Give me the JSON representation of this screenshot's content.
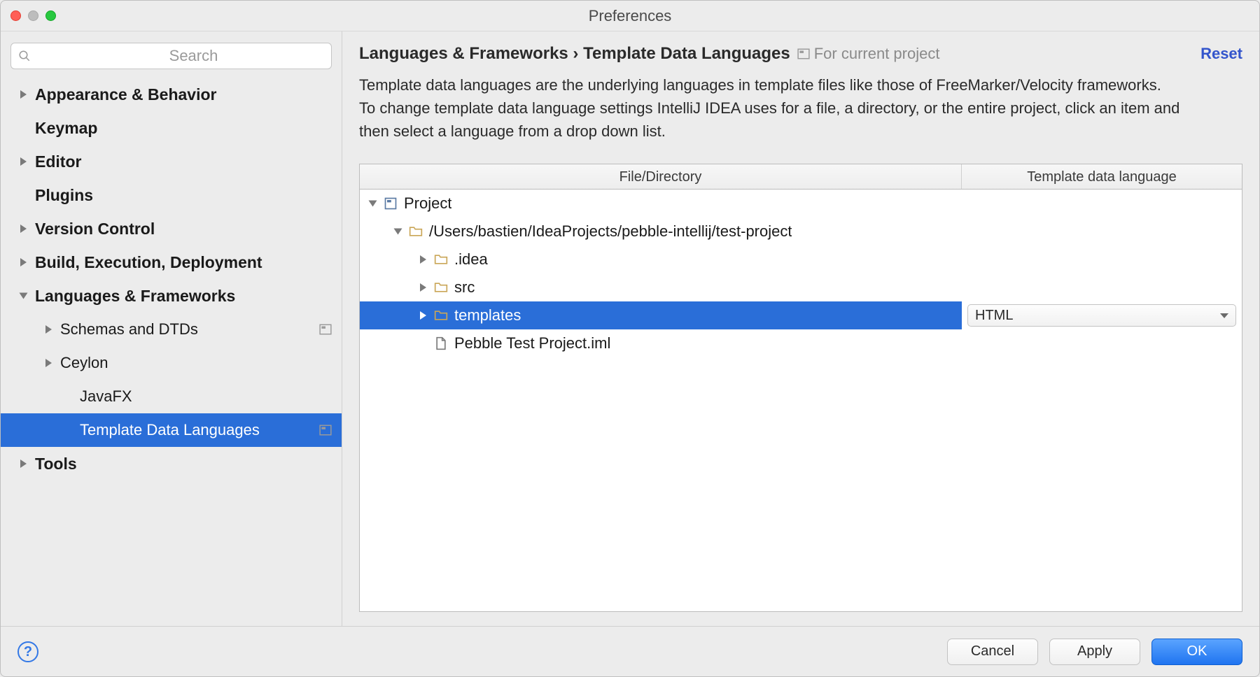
{
  "window": {
    "title": "Preferences"
  },
  "search": {
    "placeholder": "Search"
  },
  "sidebar": {
    "items": [
      {
        "label": "Appearance & Behavior",
        "bold": true,
        "expandable": true
      },
      {
        "label": "Keymap",
        "bold": true,
        "expandable": false
      },
      {
        "label": "Editor",
        "bold": true,
        "expandable": true
      },
      {
        "label": "Plugins",
        "bold": true,
        "expandable": false
      },
      {
        "label": "Version Control",
        "bold": true,
        "expandable": true
      },
      {
        "label": "Build, Execution, Deployment",
        "bold": true,
        "expandable": true
      },
      {
        "label": "Languages & Frameworks",
        "bold": true,
        "expandable": true,
        "open": true
      },
      {
        "label": "Schemas and DTDs",
        "child": true,
        "expandable": true,
        "scope": true
      },
      {
        "label": "Ceylon",
        "child": true,
        "expandable": true
      },
      {
        "label": "JavaFX",
        "grandchild": true,
        "expandable": false
      },
      {
        "label": "Template Data Languages",
        "grandchild": true,
        "expandable": false,
        "scope": true,
        "selected": true
      },
      {
        "label": "Tools",
        "bold": true,
        "expandable": true
      }
    ]
  },
  "main": {
    "breadcrumb1": "Languages & Frameworks",
    "breadcrumb_sep": " › ",
    "breadcrumb2": "Template Data Languages",
    "scope_label": "For current project",
    "reset": "Reset",
    "description": "Template data languages are the underlying languages in template files like those of FreeMarker/Velocity frameworks.\nTo change template data language settings IntelliJ IDEA uses for a file, a directory, or the entire project, click an item and then select a language from a drop down list."
  },
  "table": {
    "col1": "File/Directory",
    "col2": "Template data language",
    "rows": [
      {
        "indent": 0,
        "disclosure": "open",
        "icon": "project",
        "label": "Project"
      },
      {
        "indent": 1,
        "disclosure": "open",
        "icon": "folder",
        "label": "/Users/bastien/IdeaProjects/pebble-intellij/test-project"
      },
      {
        "indent": 2,
        "disclosure": "closed",
        "icon": "folder",
        "label": ".idea"
      },
      {
        "indent": 2,
        "disclosure": "closed",
        "icon": "folder",
        "label": "src"
      },
      {
        "indent": 2,
        "disclosure": "closed",
        "icon": "folder",
        "label": "templates",
        "selected": true,
        "lang": "HTML"
      },
      {
        "indent": 2,
        "disclosure": "none",
        "icon": "file",
        "label": "Pebble Test Project.iml"
      }
    ]
  },
  "footer": {
    "help": "?",
    "cancel": "Cancel",
    "apply": "Apply",
    "ok": "OK"
  }
}
